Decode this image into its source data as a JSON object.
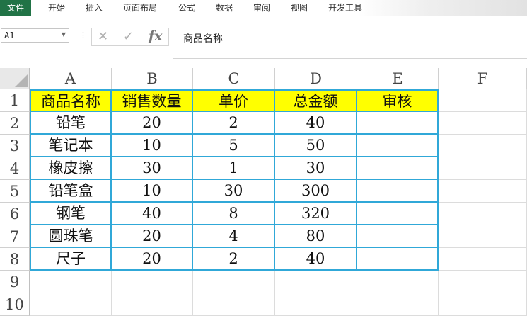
{
  "ribbon": {
    "tabs": [
      "文件",
      "开始",
      "插入",
      "页面布局",
      "公式",
      "数据",
      "审阅",
      "视图",
      "开发工具"
    ]
  },
  "formula_bar": {
    "name_box": "A1",
    "fx_label": "fx",
    "formula": "商品名称"
  },
  "sheet": {
    "columns": [
      "A",
      "B",
      "C",
      "D",
      "E",
      "F"
    ],
    "rows": [
      "1",
      "2",
      "3",
      "4",
      "5",
      "6",
      "7",
      "8",
      "9",
      "10"
    ],
    "header": [
      "商品名称",
      "销售数量",
      "单价",
      "总金额",
      "审核"
    ],
    "data": [
      [
        "铅笔",
        "20",
        "2",
        "40",
        ""
      ],
      [
        "笔记本",
        "10",
        "5",
        "50",
        ""
      ],
      [
        "橡皮擦",
        "30",
        "1",
        "30",
        ""
      ],
      [
        "铅笔盒",
        "10",
        "30",
        "300",
        ""
      ],
      [
        "钢笔",
        "40",
        "8",
        "320",
        ""
      ],
      [
        "圆珠笔",
        "20",
        "4",
        "80",
        ""
      ],
      [
        "尺子",
        "20",
        "2",
        "40",
        ""
      ]
    ]
  },
  "colors": {
    "header_fill": "#ffff00",
    "table_border": "#30a8d8",
    "file_tab": "#217346"
  }
}
